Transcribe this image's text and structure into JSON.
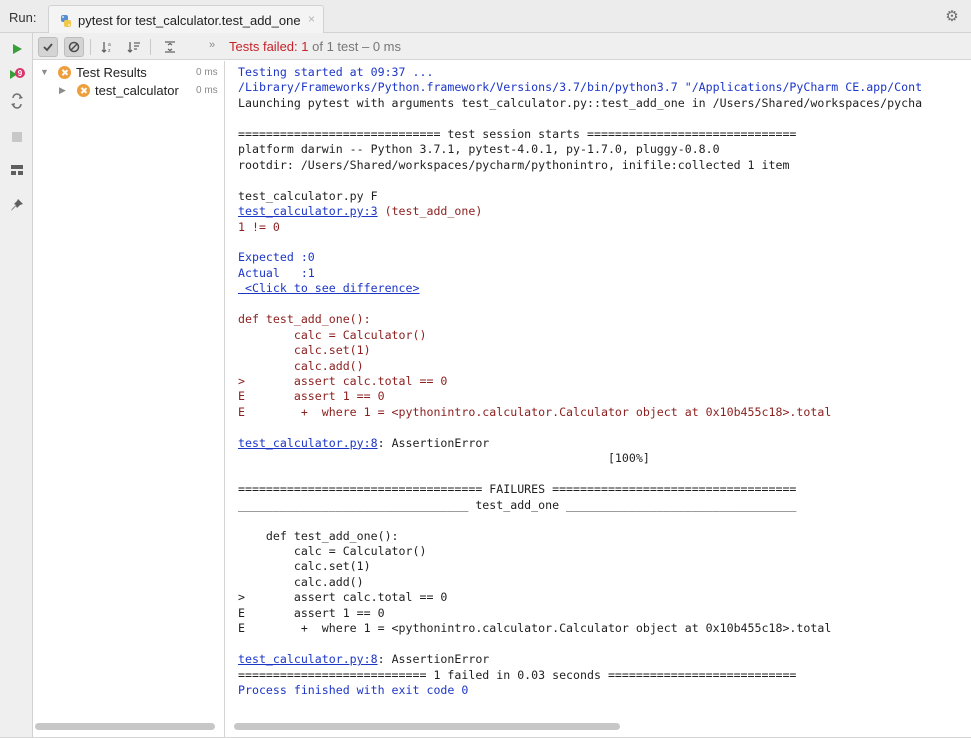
{
  "run_label": "Run:",
  "tab": {
    "title": "pytest for test_calculator.test_add_one",
    "close": "×"
  },
  "toolbar": {
    "chevrons": "»",
    "status_failed": "Tests failed: 1",
    "status_rest": " of 1 test – 0 ms"
  },
  "tree": [
    {
      "label": "Test Results",
      "time": "0 ms"
    },
    {
      "label": "test_calculator",
      "time": "0 ms"
    }
  ],
  "console": [
    {
      "text": "Testing started at 09:37 ...",
      "style": "blue"
    },
    {
      "text": "/Library/Frameworks/Python.framework/Versions/3.7/bin/python3.7 \"/Applications/PyCharm CE.app/Cont",
      "style": "blue"
    },
    {
      "text": "Launching pytest with arguments test_calculator.py::test_add_one in /Users/Shared/workspaces/pycha",
      "style": "plain"
    },
    {
      "text": "",
      "style": "plain"
    },
    {
      "text": "============================= test session starts ==============================",
      "style": "plain"
    },
    {
      "text": "platform darwin -- Python 3.7.1, pytest-4.0.1, py-1.7.0, pluggy-0.8.0",
      "style": "plain"
    },
    {
      "text": "rootdir: /Users/Shared/workspaces/pycharm/pythonintro, inifile:collected 1 item",
      "style": "plain"
    },
    {
      "text": "",
      "style": "plain"
    },
    {
      "text": "test_calculator.py F",
      "style": "plain"
    },
    {
      "text": "test_calculator.py:3",
      "suffix": " (test_add_one)",
      "style": "link"
    },
    {
      "text": "1 != 0",
      "style": "red"
    },
    {
      "text": "",
      "style": "plain"
    },
    {
      "text": "Expected :0",
      "style": "blue"
    },
    {
      "text": "Actual   :1",
      "style": "blue"
    },
    {
      "text": " <Click to see difference>",
      "style": "link"
    },
    {
      "text": "",
      "style": "plain"
    },
    {
      "text": "def test_add_one():",
      "style": "red"
    },
    {
      "text": "        calc = Calculator()",
      "style": "red"
    },
    {
      "text": "        calc.set(1)",
      "style": "red"
    },
    {
      "text": "        calc.add()",
      "style": "red"
    },
    {
      "text": ">       assert calc.total == 0",
      "style": "red"
    },
    {
      "text": "E       assert 1 == 0",
      "style": "red"
    },
    {
      "text": "E        +  where 1 = <pythonintro.calculator.Calculator object at 0x10b455c18>.total",
      "style": "red"
    },
    {
      "text": "",
      "style": "plain"
    },
    {
      "text": "test_calculator.py:8",
      "suffix": ": AssertionError",
      "style": "link"
    },
    {
      "text": "                                                     [100%]",
      "style": "plain"
    },
    {
      "text": "",
      "style": "plain"
    },
    {
      "text": "=================================== FAILURES ===================================",
      "style": "plain"
    },
    {
      "text": "_________________________________ test_add_one _________________________________",
      "style": "plain"
    },
    {
      "text": "",
      "style": "plain"
    },
    {
      "text": "    def test_add_one():",
      "style": "plain"
    },
    {
      "text": "        calc = Calculator()",
      "style": "plain"
    },
    {
      "text": "        calc.set(1)",
      "style": "plain"
    },
    {
      "text": "        calc.add()",
      "style": "plain"
    },
    {
      "text": ">       assert calc.total == 0",
      "style": "plain"
    },
    {
      "text": "E       assert 1 == 0",
      "style": "plain"
    },
    {
      "text": "E        +  where 1 = <pythonintro.calculator.Calculator object at 0x10b455c18>.total",
      "style": "plain"
    },
    {
      "text": "",
      "style": "plain"
    },
    {
      "text": "test_calculator.py:8",
      "suffix": ": AssertionError",
      "style": "link"
    },
    {
      "text": "=========================== 1 failed in 0.03 seconds ===========================",
      "style": "plain"
    },
    {
      "text": "Process finished with exit code 0",
      "style": "blue"
    }
  ],
  "colors": {
    "fail": "#c7222a",
    "link": "#1c36c7",
    "error_text": "#8c1e1e",
    "warning_icon": "#ee9f3d",
    "run_green": "#3aa03a"
  },
  "icons": {
    "left_toolbar": [
      "run-icon",
      "rerun-failed-icon",
      "toggle-auto-test-icon",
      "stop-icon",
      "layout-icon",
      "pin-icon"
    ],
    "toolbar": [
      "show-passed-icon",
      "show-ignored-icon",
      "sort-alpha-icon",
      "sort-duration-icon",
      "expand-all-icon"
    ]
  }
}
